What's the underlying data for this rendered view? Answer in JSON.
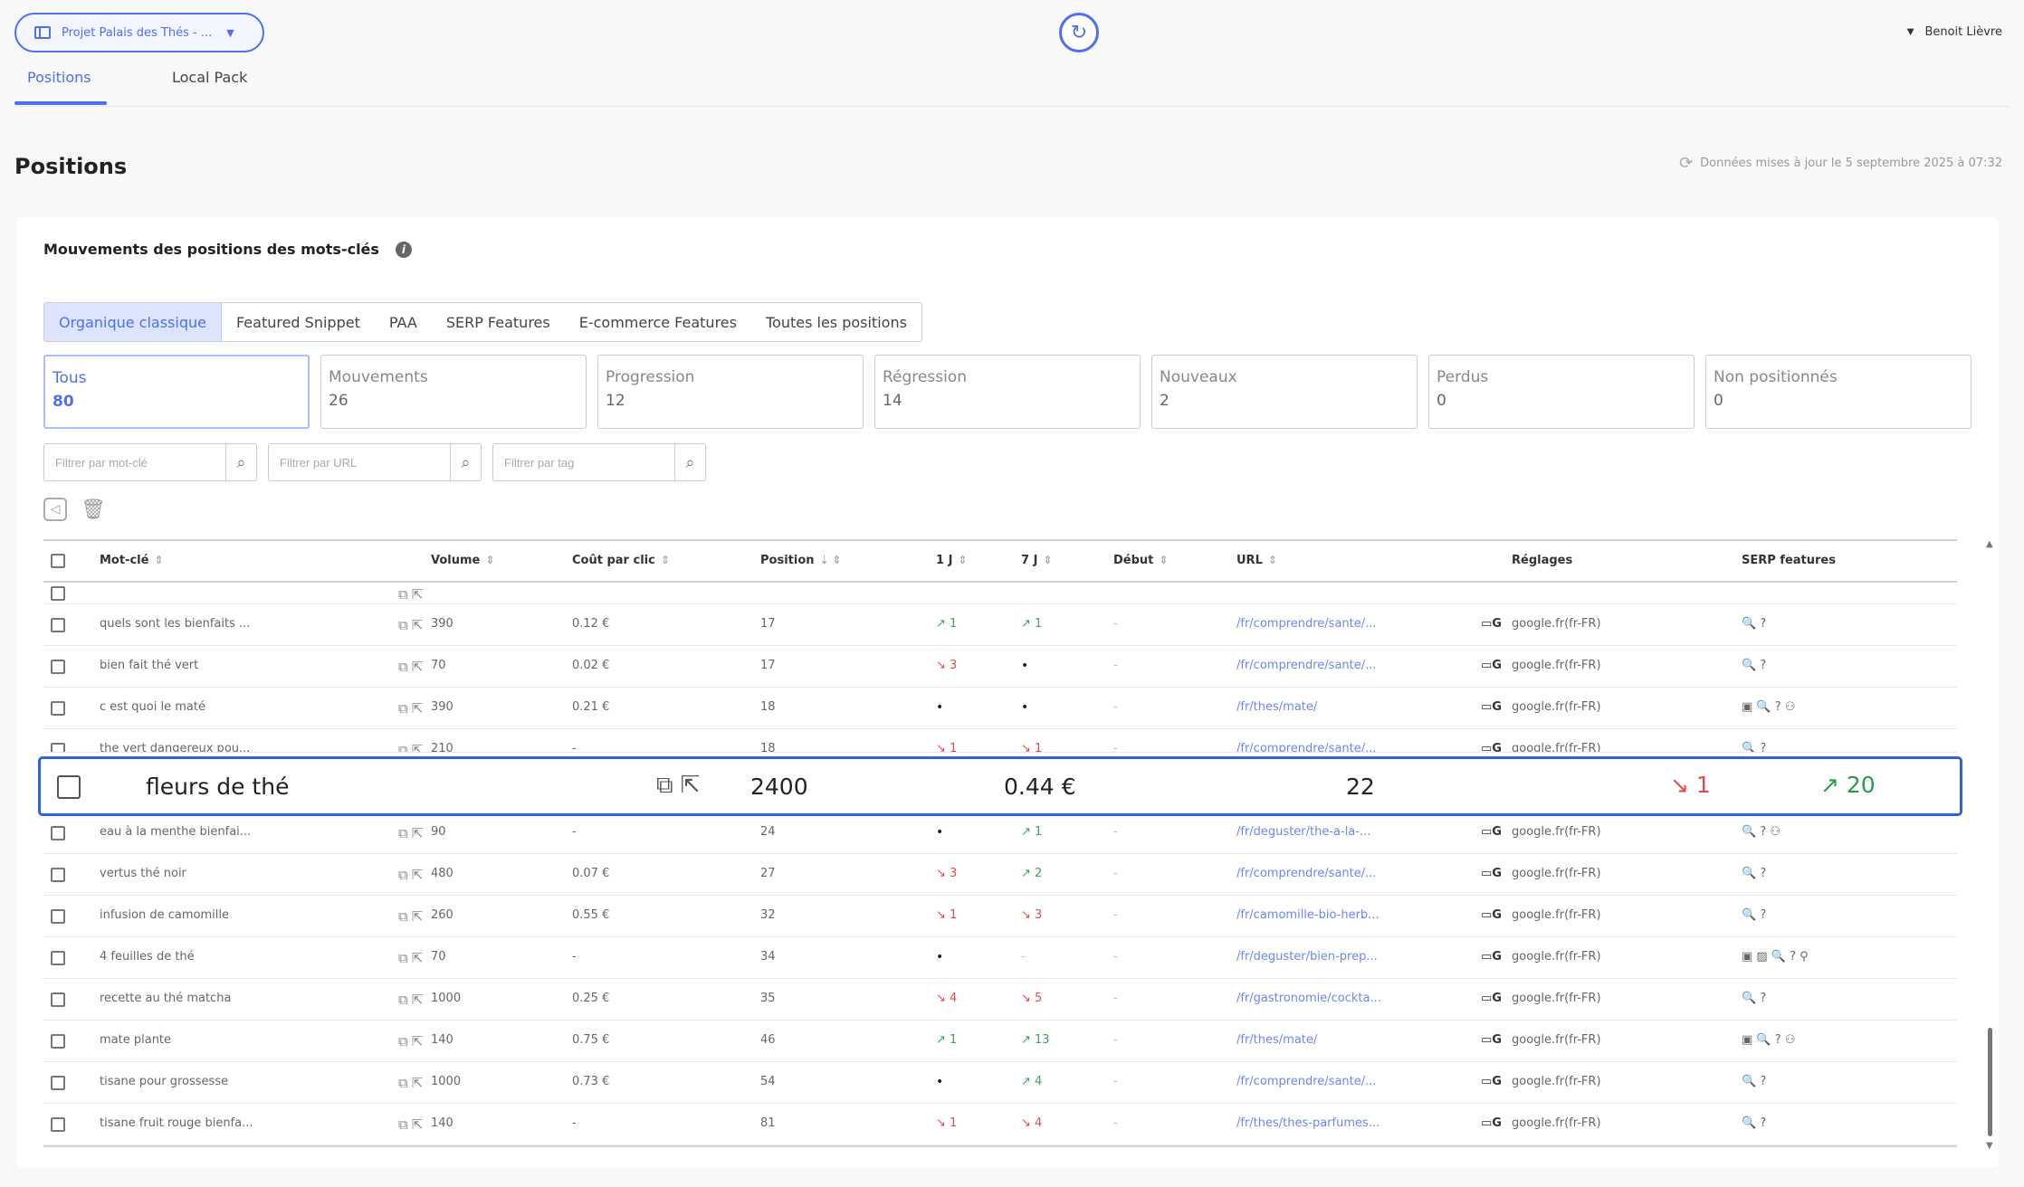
{
  "topbar": {
    "project_label": "Projet Palais des Thés - ...",
    "user_name": "Benoit Lièvre"
  },
  "tabs": [
    {
      "label": "Positions",
      "active": true
    },
    {
      "label": "Local Pack",
      "active": false
    }
  ],
  "page": {
    "title": "Positions",
    "update_note": "Données mises à jour le 5 septembre 2025 à 07:32"
  },
  "card": {
    "title": "Mouvements des positions des mots-clés",
    "segments": [
      {
        "label": "Organique classique",
        "active": true
      },
      {
        "label": "Featured Snippet"
      },
      {
        "label": "PAA"
      },
      {
        "label": "SERP Features"
      },
      {
        "label": "E-commerce Features"
      },
      {
        "label": "Toutes les positions"
      }
    ],
    "kpis": [
      {
        "label": "Tous",
        "value": "80",
        "active": true
      },
      {
        "label": "Mouvements",
        "value": "26"
      },
      {
        "label": "Progression",
        "value": "12"
      },
      {
        "label": "Régression",
        "value": "14"
      },
      {
        "label": "Nouveaux",
        "value": "2"
      },
      {
        "label": "Perdus",
        "value": "0"
      },
      {
        "label": "Non positionnés",
        "value": "0"
      }
    ],
    "filters": {
      "keyword_placeholder": "Filtrer par mot-clé",
      "url_placeholder": "Filtrer par URL",
      "tag_placeholder": "Filtrer par tag"
    }
  },
  "table": {
    "headers": {
      "keyword": "Mot-clé",
      "volume": "Volume",
      "cpc": "Coût par clic",
      "position": "Position",
      "d1": "1 J",
      "d7": "7 J",
      "start": "Début",
      "url": "URL",
      "settings": "Réglages",
      "serp": "SERP features"
    },
    "rows": [
      {
        "keyword": "quels sont les bienfaits ...",
        "volume": "390",
        "cpc": "0.12 €",
        "position": "17",
        "d1": "↗ 1",
        "d1_dir": "up",
        "d7": "↗ 1",
        "d7_dir": "up",
        "start": "-",
        "url": "/fr/comprendre/sante/...",
        "settings": "google.fr(fr-FR)",
        "serp": "🔍 ?"
      },
      {
        "keyword": "bien fait thé vert",
        "volume": "70",
        "cpc": "0.02 €",
        "position": "17",
        "d1": "↘ 3",
        "d1_dir": "down",
        "d7": "•",
        "d7_dir": "dot",
        "start": "-",
        "url": "/fr/comprendre/sante/...",
        "settings": "google.fr(fr-FR)",
        "serp": "🔍 ?"
      },
      {
        "keyword": "c est quoi le maté",
        "volume": "390",
        "cpc": "0.21 €",
        "position": "18",
        "d1": "•",
        "d1_dir": "dot",
        "d7": "•",
        "d7_dir": "dot",
        "start": "-",
        "url": "/fr/thes/mate/",
        "settings": "google.fr(fr-FR)",
        "serp": "▣ 🔍 ? ⚇"
      },
      {
        "keyword": "the vert dangereux pou...",
        "volume": "210",
        "cpc": "-",
        "position": "18",
        "d1": "↘ 1",
        "d1_dir": "down",
        "d7": "↘ 1",
        "d7_dir": "down",
        "start": "-",
        "url": "/fr/comprendre/sante/...",
        "settings": "google.fr(fr-FR)",
        "serp": "🔍 ?"
      },
      {
        "keyword": "eau à la menthe bienfai...",
        "volume": "90",
        "cpc": "-",
        "position": "24",
        "d1": "•",
        "d1_dir": "dot",
        "d7": "↗ 1",
        "d7_dir": "up",
        "start": "-",
        "url": "/fr/deguster/the-a-la-...",
        "settings": "google.fr(fr-FR)",
        "serp": "🔍 ? ⚇"
      },
      {
        "keyword": "vertus thé noir",
        "volume": "480",
        "cpc": "0.07 €",
        "position": "27",
        "d1": "↘ 3",
        "d1_dir": "down",
        "d7": "↗ 2",
        "d7_dir": "up",
        "start": "-",
        "url": "/fr/comprendre/sante/...",
        "settings": "google.fr(fr-FR)",
        "serp": "🔍 ?"
      },
      {
        "keyword": "infusion de camomille",
        "volume": "260",
        "cpc": "0.55 €",
        "position": "32",
        "d1": "↘ 1",
        "d1_dir": "down",
        "d7": "↘ 3",
        "d7_dir": "down",
        "start": "-",
        "url": "/fr/camomille-bio-herb...",
        "settings": "google.fr(fr-FR)",
        "serp": "🔍 ?"
      },
      {
        "keyword": "4 feuilles de thé",
        "volume": "70",
        "cpc": "-",
        "position": "34",
        "d1": "•",
        "d1_dir": "dot",
        "d7": "-",
        "d7_dir": "none",
        "start": "-",
        "url": "/fr/deguster/bien-prep...",
        "settings": "google.fr(fr-FR)",
        "serp": "▣ ▨ 🔍 ? ⚲"
      },
      {
        "keyword": "recette au thé matcha",
        "volume": "1000",
        "cpc": "0.25 €",
        "position": "35",
        "d1": "↘ 4",
        "d1_dir": "down",
        "d7": "↘ 5",
        "d7_dir": "down",
        "start": "-",
        "url": "/fr/gastronomie/cockta...",
        "settings": "google.fr(fr-FR)",
        "serp": "🔍 ?"
      },
      {
        "keyword": "mate plante",
        "volume": "140",
        "cpc": "0.75 €",
        "position": "46",
        "d1": "↗ 1",
        "d1_dir": "up",
        "d7": "↗ 13",
        "d7_dir": "up",
        "start": "-",
        "url": "/fr/thes/mate/",
        "settings": "google.fr(fr-FR)",
        "serp": "▣ 🔍 ? ⚇"
      },
      {
        "keyword": "tisane pour grossesse",
        "volume": "1000",
        "cpc": "0.73 €",
        "position": "54",
        "d1": "•",
        "d1_dir": "dot",
        "d7": "↗ 4",
        "d7_dir": "up",
        "start": "-",
        "url": "/fr/comprendre/sante/...",
        "settings": "google.fr(fr-FR)",
        "serp": "🔍 ?"
      },
      {
        "keyword": "tisane fruit rouge bienfa...",
        "volume": "140",
        "cpc": "-",
        "position": "81",
        "d1": "↘ 1",
        "d1_dir": "down",
        "d7": "↘ 4",
        "d7_dir": "down",
        "start": "-",
        "url": "/fr/thes/thes-parfumes...",
        "settings": "google.fr(fr-FR)",
        "serp": "🔍 ?"
      }
    ],
    "highlighted_row": {
      "keyword": "fleurs de thé",
      "volume": "2400",
      "cpc": "0.44 €",
      "position": "22",
      "d1": "1",
      "d7": "20"
    }
  }
}
